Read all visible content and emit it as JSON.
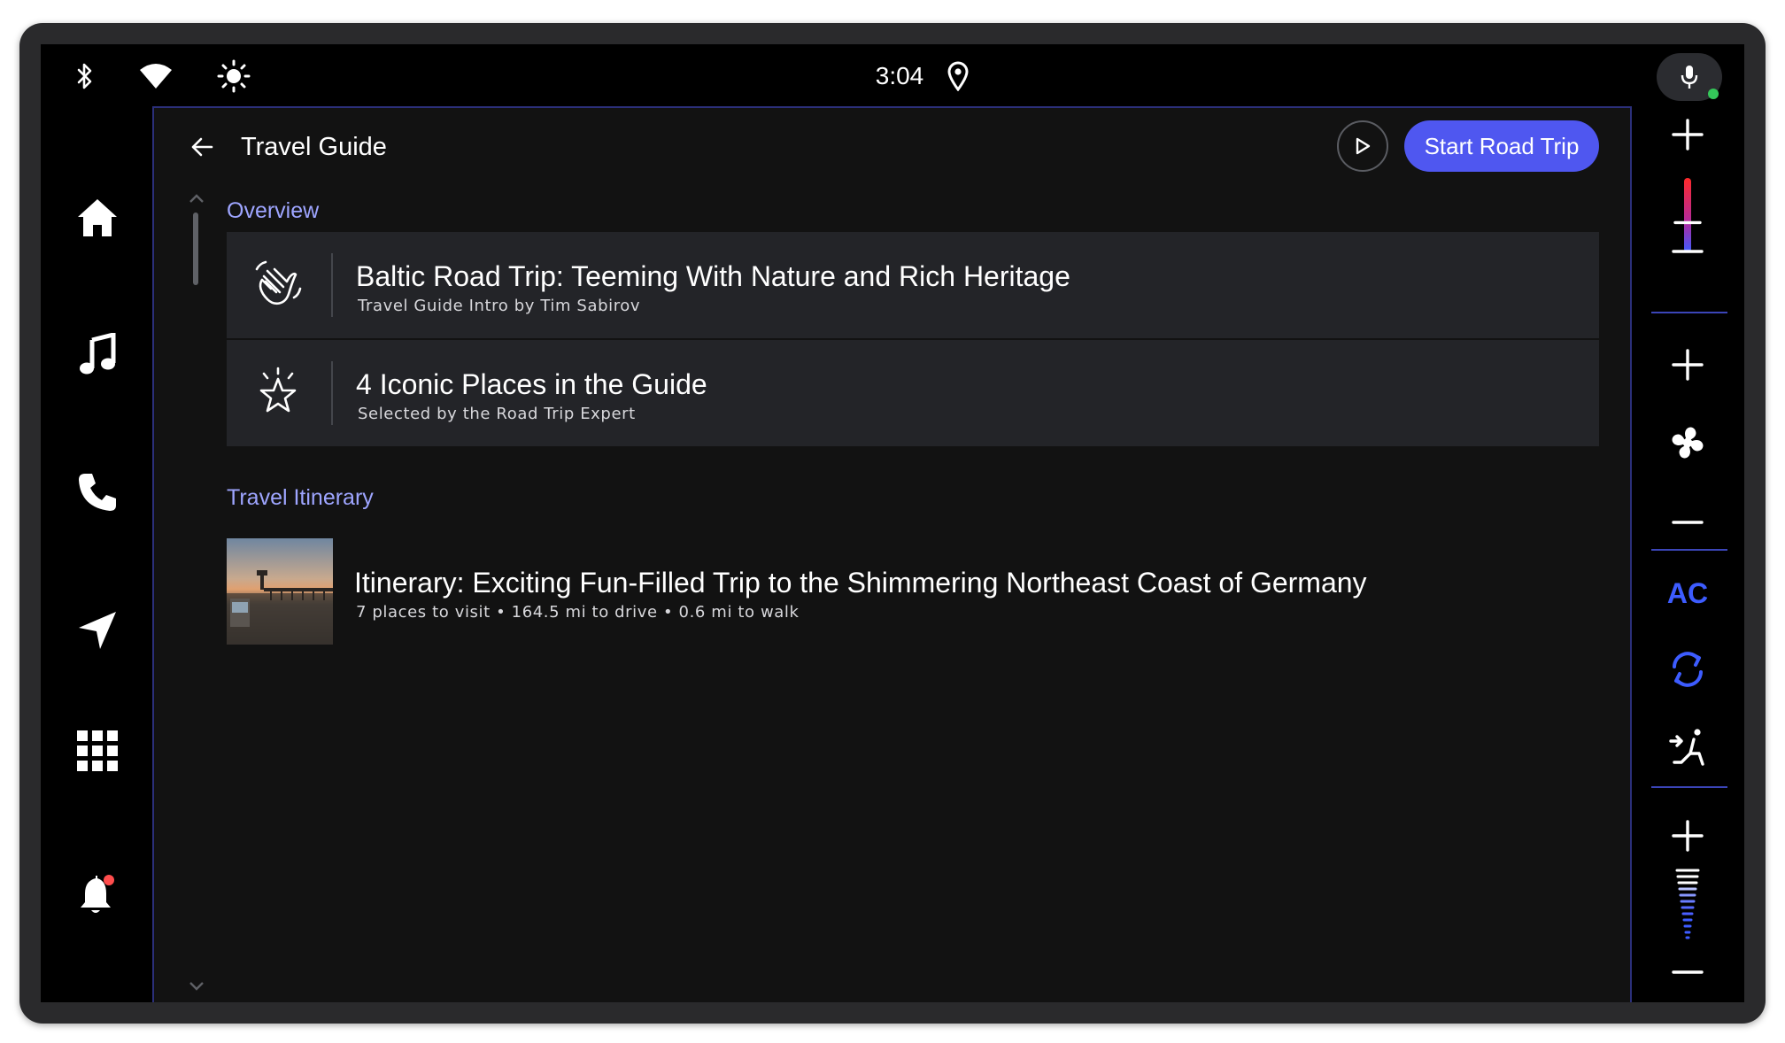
{
  "status_bar": {
    "time": "3:04",
    "icons": [
      "bluetooth-icon",
      "wifi-icon",
      "brightness-icon",
      "location-pin-icon",
      "microphone-icon"
    ]
  },
  "left_rail": {
    "items": [
      "home-icon",
      "music-note-icon",
      "phone-icon",
      "navigation-arrow-icon",
      "app-grid-icon",
      "notification-bell-icon"
    ]
  },
  "header": {
    "title": "Travel Guide",
    "primary_action": "Start Road Trip"
  },
  "sections": {
    "overview": {
      "label": "Overview",
      "items": [
        {
          "title": "Baltic Road Trip: Teeming With Nature and Rich Heritage",
          "subtitle": "Travel Guide Intro by Tim Sabirov",
          "icon": "waving-hand-icon"
        },
        {
          "title": "4 Iconic Places in the Guide",
          "subtitle": "Selected by the Road Trip Expert",
          "icon": "sparkle-star-icon"
        }
      ]
    },
    "itinerary": {
      "label": "Travel Itinerary",
      "item": {
        "title": "Itinerary: Exciting Fun-Filled Trip to the Shimmering Northeast Coast of Germany",
        "subtitle": "7 places to visit • 164.5 mi to drive • 0.6 mi to walk"
      }
    }
  },
  "climate": {
    "ac_label": "AC",
    "temperature_level": 0.4,
    "fan_level": 0.5
  },
  "colors": {
    "accent": "#4f57f0",
    "section_label": "#9ea5ff",
    "card_bg": "#232428",
    "content_bg": "#121212",
    "rail_border": "#2b2f7a",
    "ac_blue": "#3d5cff"
  }
}
